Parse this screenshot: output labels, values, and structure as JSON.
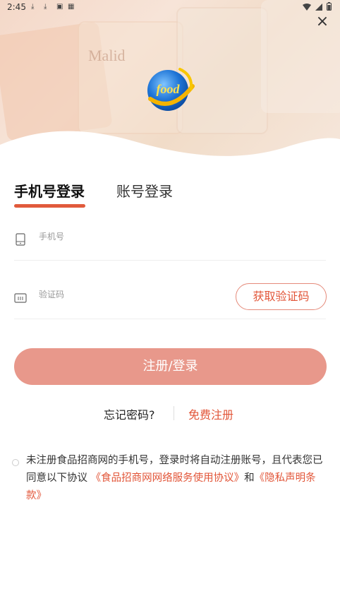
{
  "status_bar": {
    "time": "2:45",
    "icons": [
      "download-icon",
      "download-icon",
      "notification-icon",
      "sim-icon"
    ],
    "right_icons": [
      "wifi-icon",
      "signal-icon",
      "battery-icon"
    ]
  },
  "hero": {
    "logo_text": "food",
    "package_text": "Malid"
  },
  "close_icon": "×",
  "tabs": [
    {
      "label": "手机号登录",
      "active": true
    },
    {
      "label": "账号登录",
      "active": false
    }
  ],
  "phone_field": {
    "placeholder": "手机号",
    "icon": "phone-icon"
  },
  "code_field": {
    "placeholder": "验证码",
    "icon": "keyboard-icon"
  },
  "get_code_label": "获取验证码",
  "login_label": "注册/登录",
  "forgot_label": "忘记密码?",
  "register_label": "免费注册",
  "agreement": {
    "prefix": "未注册食品招商网的手机号，登录时将自动注册账号，且代表您已同意以下协议",
    "link1": "《食品招商网网络服务使用协议》",
    "middle": "和",
    "link2": "《隐私声明条款》"
  },
  "colors": {
    "accent": "#e25538",
    "button_bg": "#e8988b"
  }
}
